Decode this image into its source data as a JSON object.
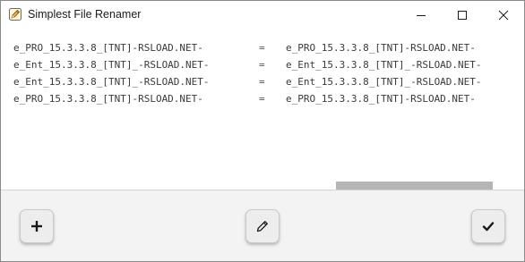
{
  "window": {
    "title": "Simplest File Renamer",
    "icon": "pencil-app-icon"
  },
  "title_controls": {
    "minimize_icon": "minimize-icon",
    "maximize_icon": "maximize-icon",
    "close_icon": "close-icon"
  },
  "rename_rows": [
    {
      "original": "e_PRO_15.3.3.8_[TNT]-RSLOAD.NET-",
      "separator": "=",
      "renamed": "e_PRO_15.3.3.8_[TNT]-RSLOAD.NET-"
    },
    {
      "original": "e_Ent_15.3.3.8_[TNT]_-RSLOAD.NET-",
      "separator": "=",
      "renamed": "e_Ent_15.3.3.8_[TNT]_-RSLOAD.NET-"
    },
    {
      "original": "e_Ent_15.3.3.8_[TNT]_-RSLOAD.NET-",
      "separator": "=",
      "renamed": "e_Ent_15.3.3.8_[TNT]_-RSLOAD.NET-"
    },
    {
      "original": "e_PRO_15.3.3.8_[TNT]-RSLOAD.NET-",
      "separator": "=",
      "renamed": "e_PRO_15.3.3.8_[TNT]-RSLOAD.NET-"
    }
  ],
  "horizontal_scroll": {
    "position_fraction": 0.64,
    "visible_fraction": 0.3
  },
  "actions": {
    "add_icon": "plus-icon",
    "edit_icon": "pencil-icon",
    "apply_icon": "checkmark-icon"
  }
}
